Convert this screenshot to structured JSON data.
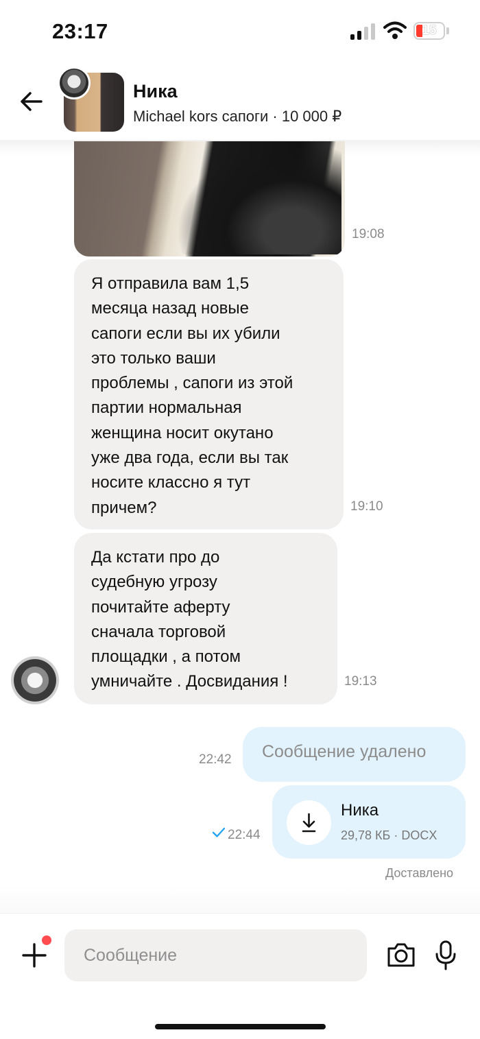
{
  "status_bar": {
    "time": "23:17",
    "battery": "15",
    "icons": [
      "cellular-signal-icon",
      "wifi-icon",
      "battery-icon"
    ]
  },
  "header": {
    "back_icon": "arrow-left-icon",
    "name": "Ника",
    "subtitle": "Michael kors сапоги · 10 000 ₽"
  },
  "messages": [
    {
      "type": "image",
      "time": "19:08"
    },
    {
      "type": "incoming",
      "lines": [
        "Я отправила вам 1,5",
        "месяца назад новые",
        "сапоги если вы их убили",
        "это только ваши",
        "проблемы , сапоги из этой",
        "партии нормальная",
        "женщина носит окутано",
        "уже два года, если вы так",
        "носите классно я тут",
        "причем?"
      ],
      "time": "19:10"
    },
    {
      "type": "incoming",
      "lines": [
        "Да кстати про до",
        "судебную  угрозу",
        "почитайте аферту",
        "сначала торговой",
        "площадки , а потом",
        "умничайте . Досвидания !"
      ],
      "time": "19:13"
    },
    {
      "type": "outgoing",
      "text": "Сообщение удалено",
      "time": "22:42"
    },
    {
      "type": "file",
      "file_name": "Ника",
      "file_meta": "29,78 КБ · DOCX",
      "time": "22:44"
    }
  ],
  "delivery_status": "Доставлено",
  "composer": {
    "placeholder": "Сообщение",
    "icons": [
      "plus-icon",
      "camera-icon",
      "microphone-icon"
    ]
  },
  "colors": {
    "incoming_bubble": "#f1f0ef",
    "outgoing_bubble": "#e3f3fd",
    "check": "#1fa3f2",
    "badge_dot": "#ff4d4f"
  }
}
